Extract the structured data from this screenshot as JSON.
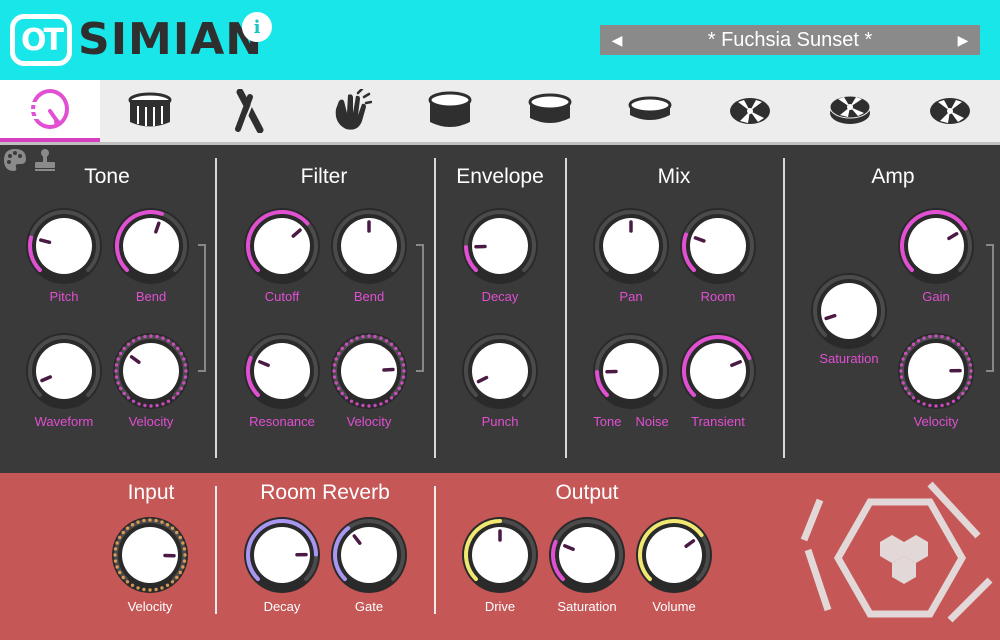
{
  "app": {
    "logo_badge": "OT",
    "logo_text": "SIMIAN",
    "info_icon": "info-icon",
    "preset_name": "* Fuchsia Sunset *",
    "prev_icon": "◀",
    "next_icon": "▶"
  },
  "tabs": [
    {
      "icon": "kick-drum-icon",
      "active": true
    },
    {
      "icon": "snare-drum-icon",
      "active": false
    },
    {
      "icon": "sticks-icon",
      "active": false
    },
    {
      "icon": "clap-icon",
      "active": false
    },
    {
      "icon": "tom-icon",
      "active": false
    },
    {
      "icon": "tom-icon",
      "active": false
    },
    {
      "icon": "tom-icon",
      "active": false
    },
    {
      "icon": "cymbal-icon",
      "active": false
    },
    {
      "icon": "cymbal-icon",
      "active": false
    },
    {
      "icon": "cymbal-icon",
      "active": false
    }
  ],
  "toolbar": {
    "palette_icon": "palette-icon",
    "stamp_icon": "stamp-icon"
  },
  "sections": {
    "tone": "Tone",
    "filter": "Filter",
    "envelope": "Envelope",
    "mix": "Mix",
    "amp": "Amp",
    "input": "Input",
    "room_reverb": "Room Reverb",
    "output": "Output"
  },
  "knobs": {
    "pitch": {
      "label": "Pitch",
      "value": 0.22
    },
    "bend": {
      "label": "Bend",
      "value": 0.57
    },
    "waveform": {
      "label": "Waveform",
      "value": 0.08
    },
    "tone_velocity": {
      "label": "Velocity",
      "value": 0.3
    },
    "cutoff": {
      "label": "Cutoff",
      "value": 0.68
    },
    "filter_bend": {
      "label": "Bend",
      "value": 0.5
    },
    "resonance": {
      "label": "Resonance",
      "value": 0.25
    },
    "filter_velocity": {
      "label": "Velocity",
      "value": 0.82
    },
    "decay": {
      "label": "Decay",
      "value": 0.16
    },
    "punch": {
      "label": "Punch",
      "value": 0.07
    },
    "pan": {
      "label": "Pan",
      "value": 0.5
    },
    "room": {
      "label": "Room",
      "value": 0.24
    },
    "tone_noise": {
      "label_left": "Tone",
      "label_right": "Noise",
      "value": 0.16
    },
    "transient": {
      "label": "Transient",
      "value": 0.75
    },
    "saturation": {
      "label": "Saturation",
      "value": 0.1
    },
    "gain": {
      "label": "Gain",
      "value": 0.72
    },
    "amp_velocity": {
      "label": "Velocity",
      "value": 0.83
    },
    "input_velocity": {
      "label": "Velocity",
      "value": 0.84
    },
    "reverb_decay": {
      "label": "Decay",
      "value": 0.83
    },
    "reverb_gate": {
      "label": "Gate",
      "value": 0.36
    },
    "drive": {
      "label": "Drive",
      "value": 0.5
    },
    "out_saturation": {
      "label": "Saturation",
      "value": 0.25
    },
    "volume": {
      "label": "Volume",
      "value": 0.7
    }
  },
  "colors": {
    "header": "#19e6e8",
    "accent": "#e14fd2",
    "panel": "#3a3a3a",
    "fx_panel": "#c55757",
    "reverb_ring": "#a996f0",
    "output_ring": "#f0e870",
    "input_ring": "#f0a85a"
  }
}
